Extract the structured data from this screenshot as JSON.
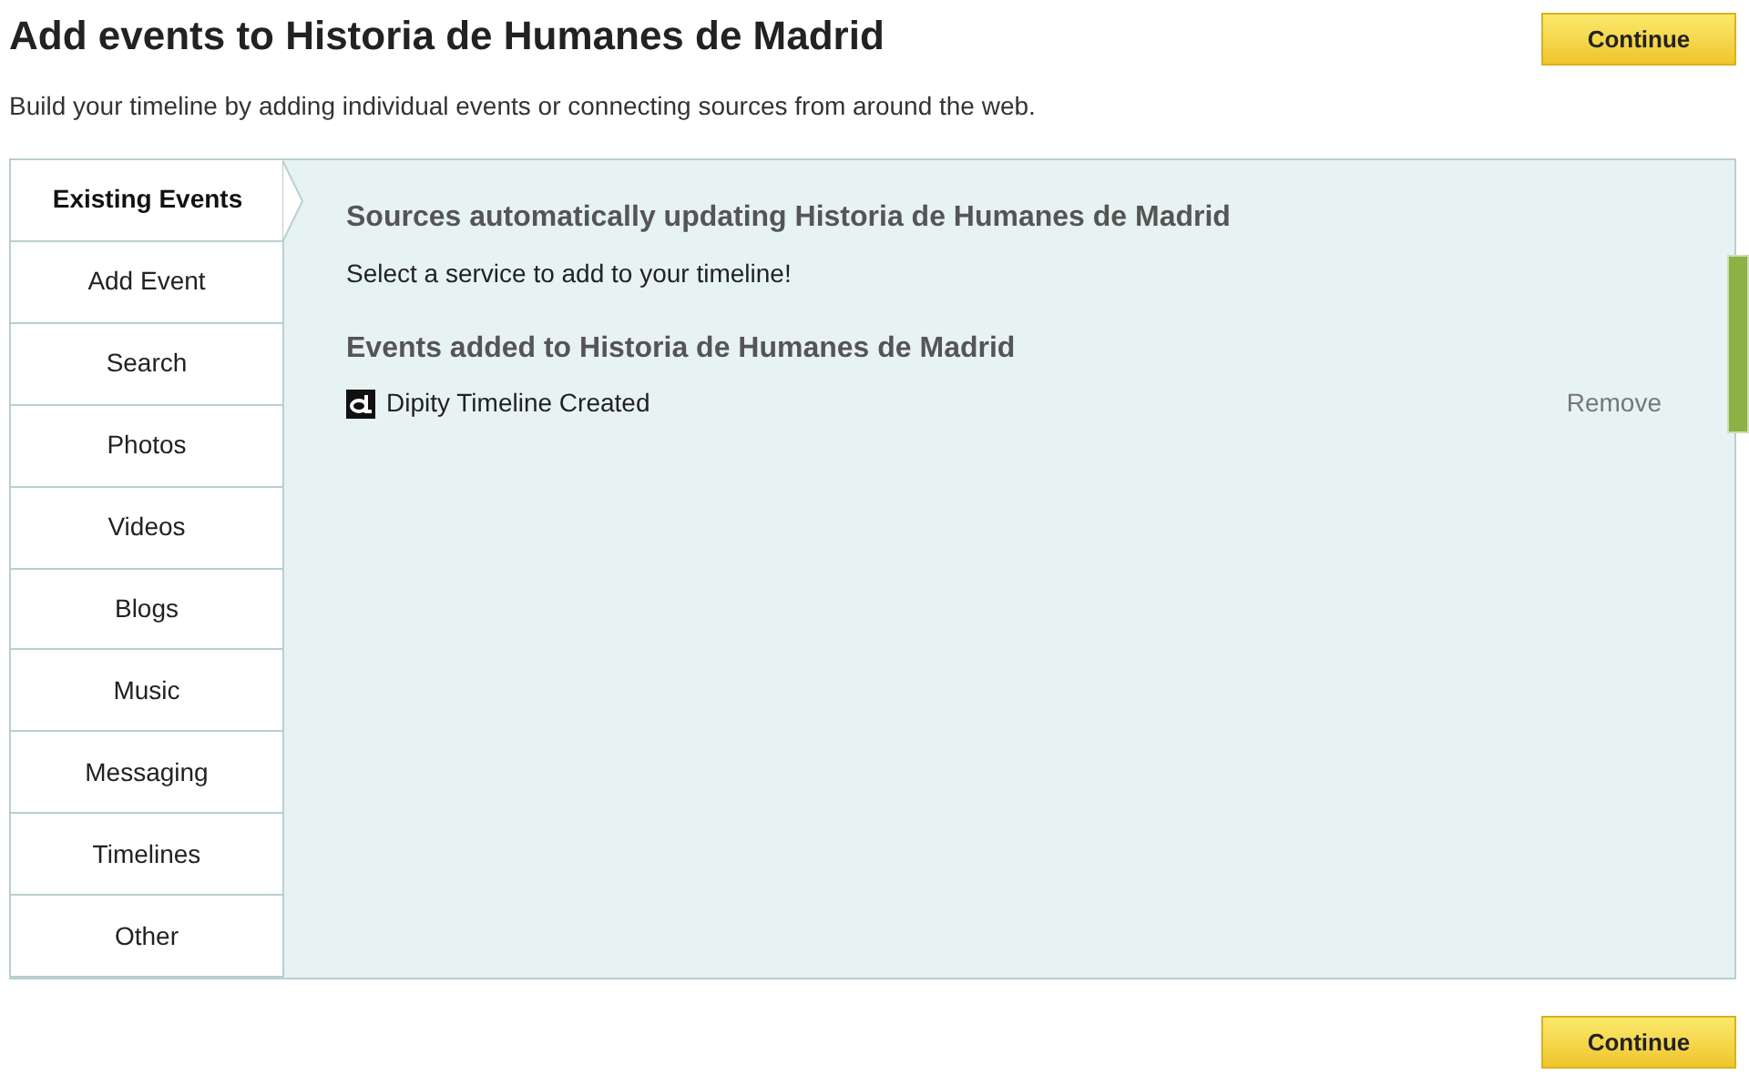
{
  "header": {
    "title": "Add events to Historia de Humanes de Madrid",
    "subtitle": "Build your timeline by adding individual events or connecting sources from around the web.",
    "continue_button": "Continue"
  },
  "tabs": [
    {
      "label": "Existing Events",
      "selected": true
    },
    {
      "label": "Add Event",
      "selected": false
    },
    {
      "label": "Search",
      "selected": false
    },
    {
      "label": "Photos",
      "selected": false
    },
    {
      "label": "Videos",
      "selected": false
    },
    {
      "label": "Blogs",
      "selected": false
    },
    {
      "label": "Music",
      "selected": false
    },
    {
      "label": "Messaging",
      "selected": false
    },
    {
      "label": "Timelines",
      "selected": false
    },
    {
      "label": "Other",
      "selected": false
    }
  ],
  "sources": {
    "heading": "Sources automatically updating Historia de Humanes de Madrid",
    "hint": "Select a service to add to your timeline!"
  },
  "events": {
    "heading": "Events added to Historia de Humanes de Madrid",
    "items": [
      {
        "name": "Dipity Timeline Created",
        "action": "Remove"
      }
    ]
  },
  "footer": {
    "continue_button": "Continue"
  }
}
